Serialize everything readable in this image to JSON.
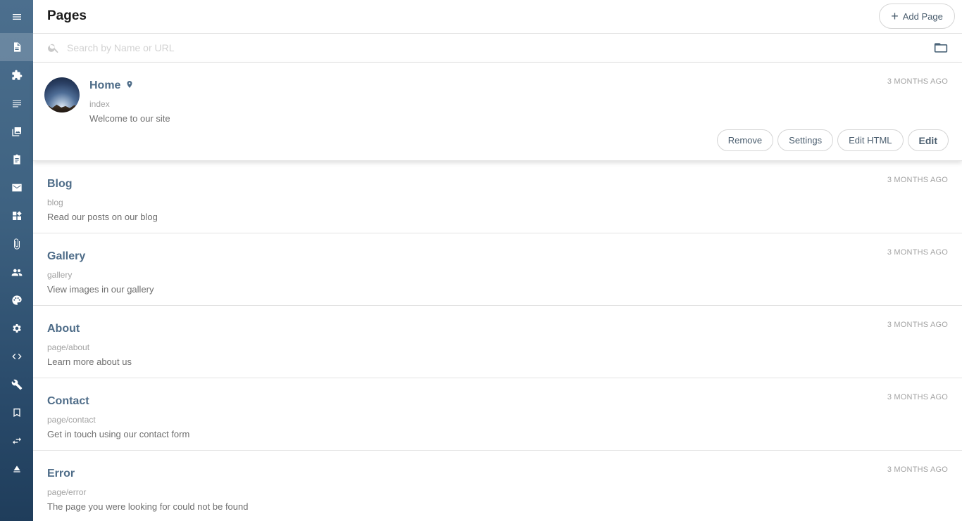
{
  "header": {
    "title": "Pages",
    "add_label": "Add Page"
  },
  "search": {
    "placeholder": "Search by Name or URL",
    "value": ""
  },
  "sidebar": {
    "items": [
      {
        "name": "menu-icon"
      },
      {
        "name": "pages-icon",
        "active": true
      },
      {
        "name": "plugins-icon"
      },
      {
        "name": "menus-icon"
      },
      {
        "name": "images-icon"
      },
      {
        "name": "forms-icon"
      },
      {
        "name": "mail-icon"
      },
      {
        "name": "components-icon"
      },
      {
        "name": "files-icon"
      },
      {
        "name": "users-icon"
      },
      {
        "name": "themes-icon"
      },
      {
        "name": "settings-icon"
      },
      {
        "name": "developer-icon"
      },
      {
        "name": "tools-icon"
      },
      {
        "name": "bookmarks-icon"
      },
      {
        "name": "sync-icon"
      },
      {
        "name": "eject-icon"
      }
    ]
  },
  "pages": [
    {
      "name": "Home",
      "url": "index",
      "description": "Welcome to our site",
      "time": "3 MONTHS AGO",
      "is_home": true
    },
    {
      "name": "Blog",
      "url": "blog",
      "description": "Read our posts on our blog",
      "time": "3 MONTHS AGO"
    },
    {
      "name": "Gallery",
      "url": "gallery",
      "description": "View images in our gallery",
      "time": "3 MONTHS AGO"
    },
    {
      "name": "About",
      "url": "page/about",
      "description": "Learn more about us",
      "time": "3 MONTHS AGO"
    },
    {
      "name": "Contact",
      "url": "page/contact",
      "description": "Get in touch using our contact form",
      "time": "3 MONTHS AGO"
    },
    {
      "name": "Error",
      "url": "page/error",
      "description": "The page you were looking for could not be found",
      "time": "3 MONTHS AGO"
    }
  ],
  "actions": {
    "remove": "Remove",
    "settings": "Settings",
    "edit_html": "Edit HTML",
    "edit": "Edit"
  },
  "colors": {
    "sidebar_top": "#4c6f8e",
    "sidebar_bottom": "#1f3d5b",
    "page_name": "#4e6c88"
  }
}
